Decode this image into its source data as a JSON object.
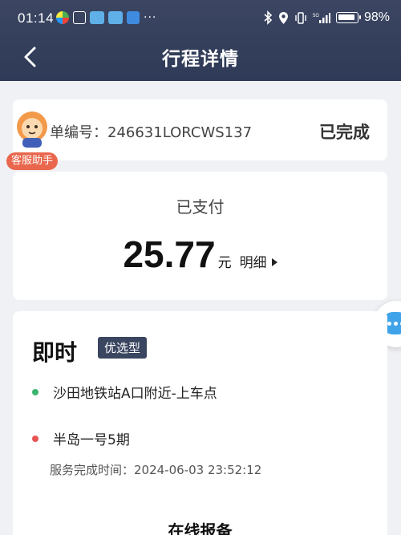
{
  "status_bar": {
    "time": "01:14",
    "battery": "98%"
  },
  "header": {
    "title": "行程详情"
  },
  "order": {
    "number": "单编号：246631LORCWS137",
    "status": "已完成"
  },
  "customer_service": {
    "label": "客服助手"
  },
  "payment": {
    "status": "已支付",
    "amount": "25.77",
    "unit": "元",
    "detail_label": "明细"
  },
  "trip": {
    "type": "即时",
    "tag": "优选型",
    "start": "沙田地铁站A口附近-上车点",
    "end": "半岛一号5期",
    "finish_time": "服务完成时间：2024-06-03 23:52:12"
  },
  "report": {
    "title": "在线报备"
  },
  "colors": {
    "header_bg": "#2e3a57",
    "tag_bg": "#3a4560",
    "start_dot": "#3cb46e",
    "end_dot": "#e85454",
    "assist_label": "#e9674d",
    "chat_icon": "#3fa3ea"
  }
}
